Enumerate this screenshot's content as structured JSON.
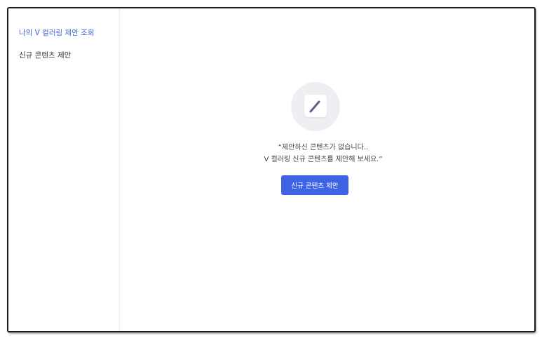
{
  "sidebar": {
    "items": [
      {
        "label": "나의 V 컬러링 제안 조회",
        "active": true
      },
      {
        "label": "신규 콘텐츠 제안",
        "active": false
      }
    ]
  },
  "empty_state": {
    "icon": "pencil-icon",
    "message_line1": "“제안하신 콘텐츠가 없습니다..",
    "message_line2": "V 컬러링 신규 콘텐츠를 제안해 보세요.”",
    "button_label": "신규 콘텐츠 제안"
  },
  "colors": {
    "accent": "#3e63e6",
    "active_nav": "#3a62d6",
    "icon_circle": "#efeff3",
    "pencil": "#5c5f87"
  }
}
